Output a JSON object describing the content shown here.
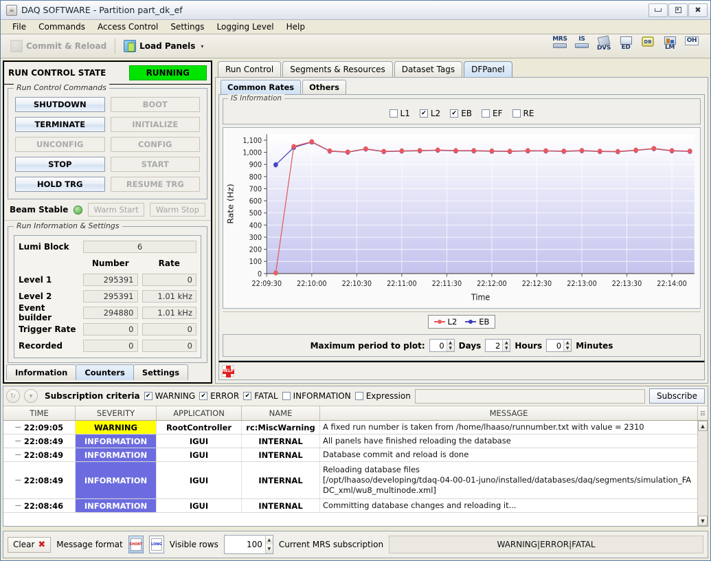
{
  "window": {
    "title": "DAQ SOFTWARE - Partition part_dk_ef",
    "app_icon": "coffee-cup-icon",
    "minimize": "minimize-icon",
    "maximize": "maximize-icon",
    "close": "close-icon"
  },
  "menu": {
    "items": [
      "File",
      "Commands",
      "Access Control",
      "Settings",
      "Logging Level",
      "Help"
    ]
  },
  "toolbar": {
    "commit_reload": "Commit & Reload",
    "load_panels": "Load Panels",
    "caret": "▾",
    "icons": [
      {
        "label": "MRS",
        "name": "mrs-icon"
      },
      {
        "label": "IS",
        "name": "is-icon"
      },
      {
        "label": "DVS",
        "name": "dvs-icon"
      },
      {
        "label": "ED",
        "name": "ed-icon"
      },
      {
        "label": "DB",
        "name": "db-icon"
      },
      {
        "label": "LM",
        "name": "lm-icon"
      },
      {
        "label": "OH",
        "name": "oh-icon"
      }
    ]
  },
  "run_control": {
    "header_title": "RUN CONTROL STATE",
    "state": "RUNNING",
    "state_color": "#00e400",
    "commands_group_label": "Run Control Commands",
    "buttons": [
      {
        "label": "SHUTDOWN",
        "enabled": true
      },
      {
        "label": "BOOT",
        "enabled": false
      },
      {
        "label": "TERMINATE",
        "enabled": true
      },
      {
        "label": "INITIALIZE",
        "enabled": false
      },
      {
        "label": "UNCONFIG",
        "enabled": false
      },
      {
        "label": "CONFIG",
        "enabled": false
      },
      {
        "label": "STOP",
        "enabled": true
      },
      {
        "label": "START",
        "enabled": false
      },
      {
        "label": "HOLD TRG",
        "enabled": true
      },
      {
        "label": "RESUME TRG",
        "enabled": false
      }
    ],
    "beam": {
      "label": "Beam Stable",
      "led_color": "#4fae45",
      "warm_start": "Warm Start",
      "warm_stop": "Warm Stop"
    },
    "info_group_label": "Run Information & Settings",
    "lumi_block_label": "Lumi Block",
    "lumi_block_value": "6",
    "col_number": "Number",
    "col_rate": "Rate",
    "rows": [
      {
        "label": "Level 1",
        "number": "295391",
        "rate": "0"
      },
      {
        "label": "Level 2",
        "number": "295391",
        "rate": "1.01 kHz"
      },
      {
        "label": "Event builder",
        "number": "294880",
        "rate": "1.01 kHz"
      },
      {
        "label": "Trigger Rate",
        "number": "0",
        "rate": "0"
      },
      {
        "label": "Recorded",
        "number": "0",
        "rate": "0"
      }
    ],
    "tabs": [
      {
        "label": "Information",
        "selected": false
      },
      {
        "label": "Counters",
        "selected": true
      },
      {
        "label": "Settings",
        "selected": false
      }
    ]
  },
  "main_tabs": [
    {
      "label": "Run Control",
      "selected": false
    },
    {
      "label": "Segments & Resources",
      "selected": false
    },
    {
      "label": "Dataset Tags",
      "selected": false
    },
    {
      "label": "DFPanel",
      "selected": true
    }
  ],
  "sub_tabs": [
    {
      "label": "Common Rates",
      "selected": true
    },
    {
      "label": "Others",
      "selected": false
    }
  ],
  "is_information": {
    "group_label": "IS Information",
    "checkboxes": [
      {
        "label": "L1",
        "checked": false
      },
      {
        "label": "L2",
        "checked": true
      },
      {
        "label": "EB",
        "checked": true
      },
      {
        "label": "EF",
        "checked": false
      },
      {
        "label": "RE",
        "checked": false
      }
    ]
  },
  "chart_data": {
    "type": "line",
    "title": "",
    "xlabel": "Time",
    "ylabel": "Rate (Hz)",
    "ylim": [
      0,
      1150
    ],
    "yticks": [
      0,
      100,
      200,
      300,
      400,
      500,
      600,
      700,
      800,
      900,
      1000,
      1100
    ],
    "ytick_labels": [
      "0",
      "100",
      "200",
      "300",
      "400",
      "500",
      "600",
      "700",
      "800",
      "900",
      "1,000",
      "1,100"
    ],
    "xtick_labels": [
      "22:09:30",
      "22:10:00",
      "22:10:30",
      "22:11:00",
      "22:11:30",
      "22:12:00",
      "22:12:30",
      "22:13:00",
      "22:13:30",
      "22:14:00"
    ],
    "x_start_sec": 555,
    "x_end_sec": 840,
    "grid": true,
    "legend_position": "bottom",
    "series": [
      {
        "name": "L2",
        "color": "#f05a5a",
        "line_color": "#e05a5a",
        "x": [
          561,
          573,
          585,
          597,
          609,
          621,
          633,
          645,
          657,
          669,
          681,
          693,
          705,
          717,
          729,
          741,
          753,
          765,
          777,
          789,
          801,
          813,
          825,
          837
        ],
        "values": [
          5,
          1048,
          1088,
          1012,
          1003,
          1029,
          1008,
          1012,
          1015,
          1019,
          1014,
          1014,
          1011,
          1009,
          1014,
          1013,
          1010,
          1015,
          1009,
          1007,
          1018,
          1032,
          1014,
          1010
        ]
      },
      {
        "name": "EB",
        "color": "#3a3ac0",
        "line_color": "#4a4ab5",
        "x": [
          561,
          573,
          585,
          597,
          609,
          621,
          633,
          645,
          657,
          669,
          681,
          693,
          705,
          717,
          729,
          741,
          753,
          765,
          777,
          789,
          801,
          813,
          825,
          837
        ],
        "values": [
          897,
          1040,
          1085,
          1010,
          1001,
          1027,
          1006,
          1010,
          1013,
          1017,
          1012,
          1012,
          1009,
          1007,
          1012,
          1011,
          1008,
          1013,
          1007,
          1005,
          1016,
          1030,
          1012,
          1008
        ]
      }
    ]
  },
  "period": {
    "label": "Maximum period to plot:",
    "days_value": "0",
    "days_label": "Days",
    "hours_value": "2",
    "hours_label": "Hours",
    "minutes_value": "0",
    "minutes_label": "Minutes"
  },
  "help_bar": {
    "icon_label": "HELP"
  },
  "mrs": {
    "subscription_label": "Subscription criteria",
    "filters": [
      {
        "label": "WARNING",
        "checked": true
      },
      {
        "label": "ERROR",
        "checked": true
      },
      {
        "label": "FATAL",
        "checked": true
      },
      {
        "label": "INFORMATION",
        "checked": false
      },
      {
        "label": "Expression",
        "checked": false
      }
    ],
    "expression_value": "",
    "subscribe_button": "Subscribe",
    "columns": [
      "TIME",
      "SEVERITY",
      "APPLICATION",
      "NAME",
      "MESSAGE"
    ],
    "rows": [
      {
        "time": "22:09:05",
        "severity": "WARNING",
        "severity_class": "warn",
        "application": "RootController",
        "name": "rc:MiscWarning",
        "message": "A fixed run number is taken from /home/lhaaso/runnumber.txt with value = 2310"
      },
      {
        "time": "22:08:49",
        "severity": "INFORMATION",
        "severity_class": "info",
        "application": "IGUI",
        "name": "INTERNAL",
        "message": "All panels have finished reloading the database"
      },
      {
        "time": "22:08:49",
        "severity": "INFORMATION",
        "severity_class": "info",
        "application": "IGUI",
        "name": "INTERNAL",
        "message": "Database commit and reload is done"
      },
      {
        "time": "22:08:49",
        "severity": "INFORMATION",
        "severity_class": "info",
        "application": "IGUI",
        "name": "INTERNAL",
        "message": "Reloading database files\n[/opt/lhaaso/developing/tdaq-04-00-01-juno/installed/databases/daq/segments/simulation_FADC_xml/wu8_multinode.xml]"
      },
      {
        "time": "22:08:46",
        "severity": "INFORMATION",
        "severity_class": "info",
        "application": "IGUI",
        "name": "INTERNAL",
        "message": "Committing database changes and reloading it..."
      }
    ]
  },
  "status": {
    "clear_label": "Clear",
    "message_format_label": "Message format",
    "format_short": "SHORT",
    "format_long": "LONG",
    "visible_rows_label": "Visible rows",
    "visible_rows_value": "100",
    "current_sub_label": "Current MRS subscription",
    "current_sub_value": "WARNING|ERROR|FATAL"
  }
}
